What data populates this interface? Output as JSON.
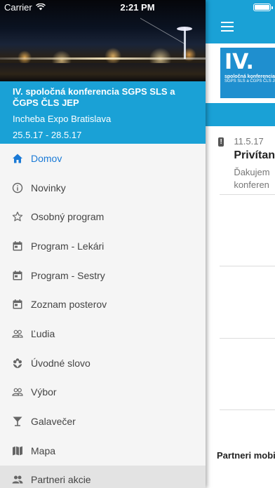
{
  "status_bar": {
    "carrier": "Carrier",
    "time": "2:21 PM"
  },
  "conference": {
    "title": "IV. spoločná konferencia SGPS SLS a ČGPS ČLS JEP",
    "venue": "Incheba Expo Bratislava",
    "dates": "25.5.17 - 28.5.17"
  },
  "menu": {
    "items": [
      {
        "label": "Domov",
        "icon": "home-icon",
        "active": true
      },
      {
        "label": "Novinky",
        "icon": "info-icon"
      },
      {
        "label": "Osobný program",
        "icon": "star-icon"
      },
      {
        "label": "Program - Lekári",
        "icon": "calendar-icon"
      },
      {
        "label": "Program - Sestry",
        "icon": "calendar-icon"
      },
      {
        "label": "Zoznam posterov",
        "icon": "calendar-icon"
      },
      {
        "label": "Ľudia",
        "icon": "people-icon"
      },
      {
        "label": "Úvodné slovo",
        "icon": "flower-icon"
      },
      {
        "label": "Výbor",
        "icon": "people-icon"
      },
      {
        "label": "Galavečer",
        "icon": "glass-icon"
      },
      {
        "label": "Mapa",
        "icon": "map-icon"
      },
      {
        "label": "Partneri akcie",
        "icon": "group-icon"
      }
    ]
  },
  "main": {
    "logo": {
      "numeral": "IV.",
      "line1": "spoločná konferencia",
      "line2": "SGPS SLS a ČGPS ČLS JEP"
    },
    "news": {
      "date": "11.5.17",
      "title": "Privítan",
      "text_line1": "Ďakujem",
      "text_line2": "konferen"
    },
    "partners_label": "Partneri mobiln"
  },
  "colors": {
    "accent": "#1aa1d6",
    "active": "#1a7ad6"
  }
}
